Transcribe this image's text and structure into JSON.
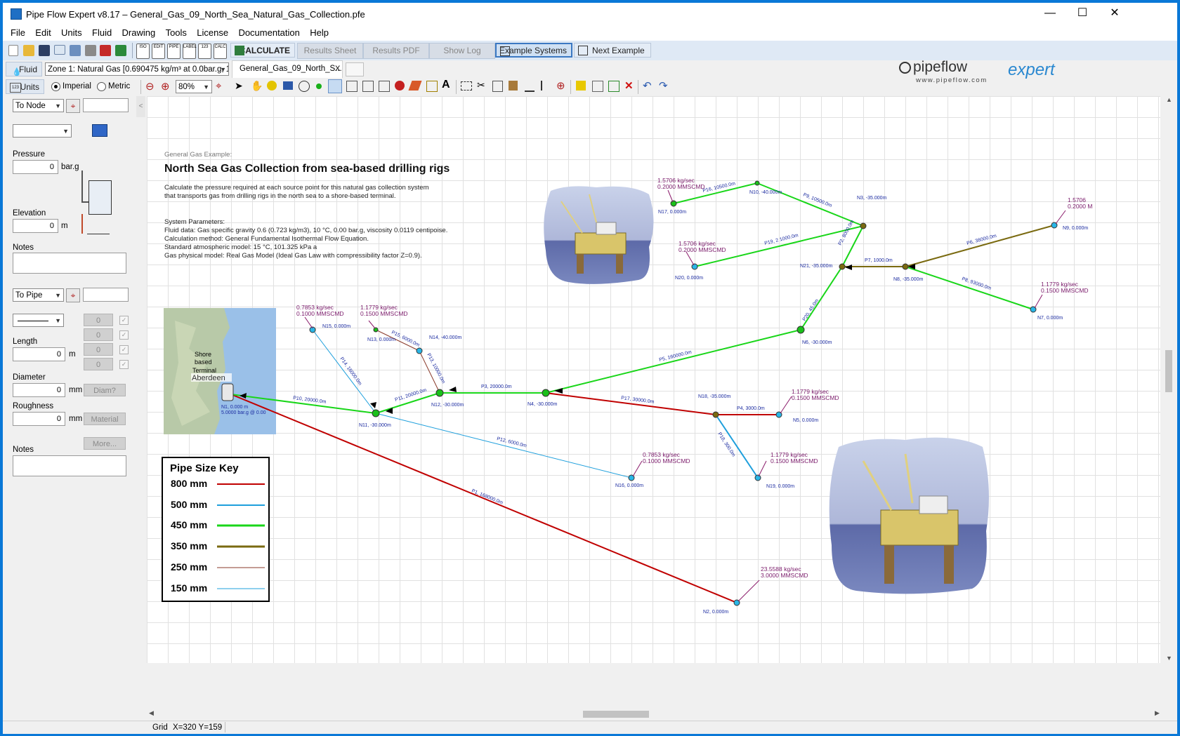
{
  "window": {
    "title": "Pipe Flow Expert v8.17 – General_Gas_09_North_Sea_Natural_Gas_Collection.pfe"
  },
  "menu": [
    "File",
    "Edit",
    "Units",
    "Fluid",
    "Drawing",
    "Tools",
    "License",
    "Documentation",
    "Help"
  ],
  "toolbar": {
    "calculate": "CALCULATE",
    "results_sheet": "Results Sheet",
    "results_pdf": "Results PDF",
    "show_log": "Show Log",
    "example_systems": "Example Systems",
    "next_example": "Next Example",
    "small_icon_labels": [
      "ISO",
      "EDIT",
      "PIPE",
      "LABEL",
      "123",
      "CALC"
    ]
  },
  "fluid_bar": {
    "fluid_button": "Fluid",
    "zone": "Zone 1: Natural Gas [0.690475 kg/m³ at 0.0bar.g, 10°",
    "tab": "General_Gas_09_North_S...",
    "tab_close": "X"
  },
  "units_bar": {
    "units_button": "Units",
    "imperial": "Imperial",
    "metric": "Metric",
    "zoom": "80%"
  },
  "logo": {
    "brand": "pipeflow",
    "product": "expert",
    "url": "www.pipeflow.com"
  },
  "left_panel": {
    "to_node": "To Node",
    "pressure_label": "Pressure",
    "pressure_value": "0",
    "pressure_unit": "bar.g",
    "elevation_label": "Elevation",
    "elevation_value": "0",
    "elevation_unit": "m",
    "notes_label": "Notes",
    "to_pipe": "To Pipe",
    "fitting_counts": [
      "0",
      "0",
      "0",
      "0"
    ],
    "length_label": "Length",
    "length_value": "0",
    "length_unit": "m",
    "diameter_label": "Diameter",
    "diameter_value": "0",
    "diameter_unit": "mm",
    "diam_button": "Diam?",
    "roughness_label": "Roughness",
    "roughness_value": "0",
    "roughness_unit": "mm",
    "material_button": "Material",
    "more_button": "More...",
    "notes2_label": "Notes",
    "collapse": "<"
  },
  "status": {
    "grid": "Grid",
    "coords": "X=320  Y=159"
  },
  "diagram": {
    "subtitle": "General Gas Example:",
    "title": "North Sea Gas Collection from sea-based drilling rigs",
    "desc": [
      "Calculate the pressure required at each source point for this natural gas collection system",
      "that transports gas from drilling rigs in the north sea to a shore-based terminal."
    ],
    "params": [
      "System Parameters:",
      "Fluid data: Gas specific gravity 0.6 (0.723 kg/m3), 10 °C, 0.00 bar.g, viscosity 0.0119 centipoise.",
      "Calculation method: General Fundamental Isothermal Flow Equation.",
      "Standard atmospheric model: 15 °C, 101.325 kPa a",
      "Gas physical model: Real Gas Model (Ideal Gas Law with compressibility factor Z=0.9)."
    ],
    "map": {
      "line1": "Shore",
      "line2": "based",
      "line3": "Terminal",
      "city": "Aberdeen"
    },
    "key": {
      "title": "Pipe Size Key",
      "rows": [
        {
          "label": "800 mm",
          "color": "#c00000"
        },
        {
          "label": "500 mm",
          "color": "#1e9fdc"
        },
        {
          "label": "450 mm",
          "color": "#19d619"
        },
        {
          "label": "350 mm",
          "color": "#7a6a10"
        },
        {
          "label": "250 mm",
          "color": "#8a3a2a"
        },
        {
          "label": "150 mm",
          "color": "#1e9fdc"
        }
      ]
    },
    "node_labels": [
      "N1, 0.000 m",
      "5.0000 bar.g @ 0.00",
      "N2, 0.000m",
      "N3, -35.000m",
      "N4, -30.000m",
      "N5, 0.000m",
      "N6, -30.000m",
      "N7, 0.000m",
      "N8, -35.000m",
      "N9, 0.000m",
      "N10, -40.000m",
      "N11, -30.000m",
      "N12, -30.000m",
      "N13, 0.000m",
      "N14, -40.000m",
      "N15, 0.000m",
      "N16, 0.000m",
      "N17, 0.000m",
      "N18, -35.000m",
      "N19, 0.000m",
      "N20, 0.000m",
      "N21, -35.000m"
    ],
    "pipe_labels": [
      "P1, 168000.0m",
      "P2, 8000.0m",
      "P3, 20000.0m",
      "P4, 3000.0m",
      "P5, 160000.0m",
      "P6, 38000.0m",
      "P7, 1000.0m",
      "P8, 93000.0m",
      "P9, 10500.0m",
      "P10, 20000.0m",
      "P11, 20000.0m",
      "P12, 6000.0m",
      "P13, 10000.0m",
      "P14, 16000.0m",
      "P15, 6000.0m",
      "P16, 10500.0m",
      "P17, 30000.0m",
      "P18, 300.0m",
      "P19, 2 1000.0m",
      "P20, 45.0m"
    ],
    "flows": [
      "1.5706 kg/sec",
      "0.2000 MMSCMD",
      "0.7853 kg/sec",
      "0.1000 MMSCMD",
      "1.1779 kg/sec",
      "0.1500 MMSCMD",
      "23.5588 kg/sec",
      "3.0000 MMSCMD",
      "1.5706",
      "0.2000 M"
    ]
  }
}
